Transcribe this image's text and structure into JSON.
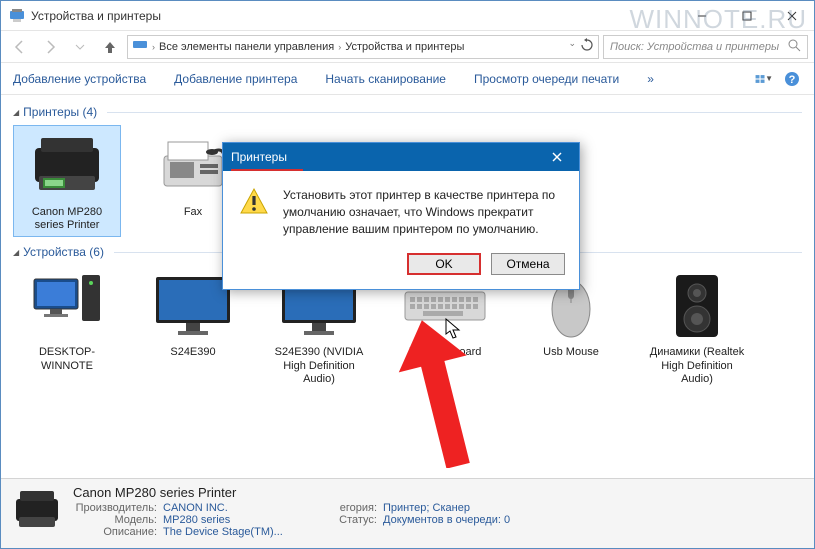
{
  "window": {
    "title": "Устройства и принтеры"
  },
  "watermark": "WINNOTE.RU",
  "nav": {
    "path1": "Все элементы панели управления",
    "path2": "Устройства и принтеры",
    "search_placeholder": "Поиск: Устройства и принтеры"
  },
  "toolbar": {
    "add_device": "Добавление устройства",
    "add_printer": "Добавление принтера",
    "start_scan": "Начать сканирование",
    "view_queue": "Просмотр очереди печати"
  },
  "groups": {
    "printers": {
      "title": "Принтеры (4)"
    },
    "devices": {
      "title": "Устройства (6)"
    }
  },
  "printers": [
    {
      "label": "Canon MP280 series Printer"
    },
    {
      "label": "Fax"
    }
  ],
  "devices": [
    {
      "label": "DESKTOP-WINNOTE"
    },
    {
      "label": "S24E390"
    },
    {
      "label": "S24E390 (NVIDIA High Definition Audio)"
    },
    {
      "label": "USB Keyboard"
    },
    {
      "label": "Usb Mouse"
    },
    {
      "label": "Динамики (Realtek High Definition Audio)"
    }
  ],
  "status": {
    "name": "Canon MP280 series Printer",
    "manufacturer_l": "Производитель:",
    "manufacturer": "CANON INC.",
    "model_l": "Модель:",
    "model": "MP280 series",
    "desc_l": "Описание:",
    "desc": "The Device Stage(TM)...",
    "category_l": "егория:",
    "category": "Принтер; Сканер",
    "state_l": "Статус:",
    "state": "Документов в очереди: 0"
  },
  "dialog": {
    "title": "Принтеры",
    "message": "Установить этот принтер в качестве принтера по умолчанию означает, что Windows прекратит управление вашим принтером по умолчанию.",
    "ok": "OK",
    "cancel": "Отмена"
  }
}
